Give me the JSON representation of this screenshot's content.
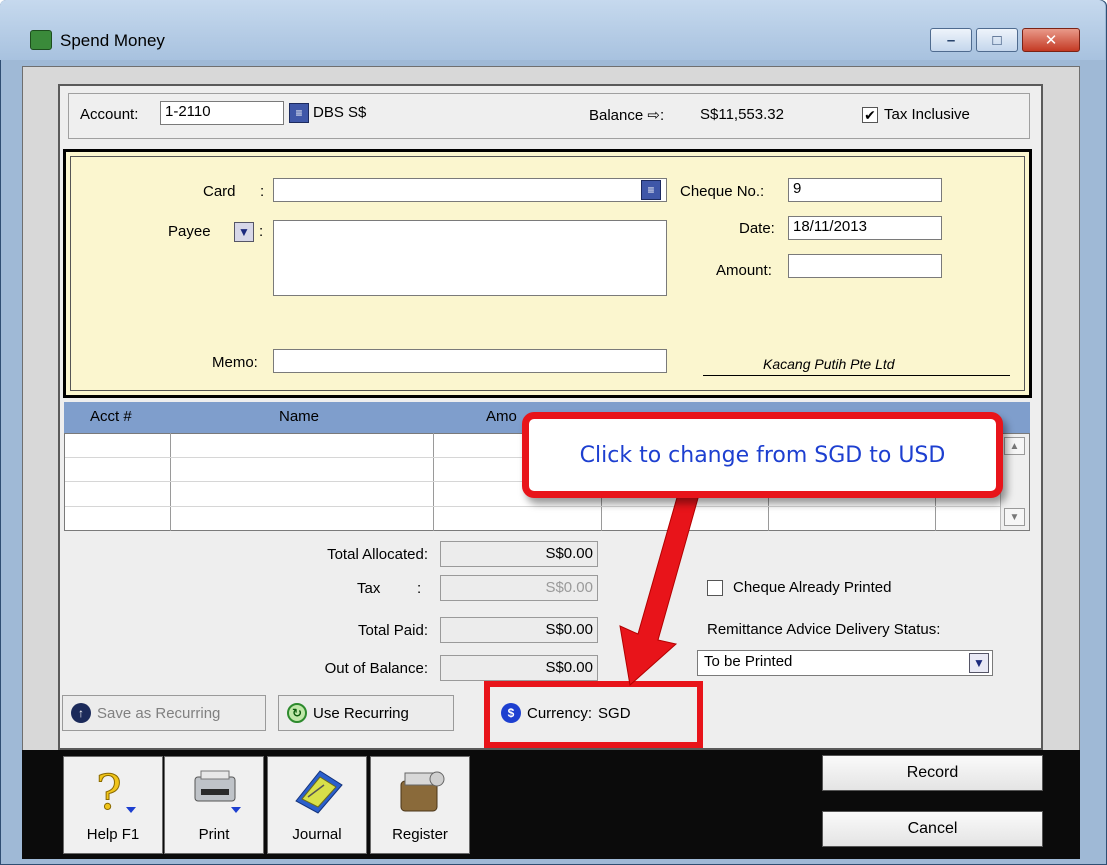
{
  "window": {
    "title": "Spend Money"
  },
  "header": {
    "account_label": "Account:",
    "account_number": "1-2110",
    "account_name": "DBS S$",
    "balance_label": "Balance ⇨:",
    "balance_value": "S$11,553.32",
    "tax_inclusive_label": "Tax Inclusive",
    "tax_inclusive_checked": true
  },
  "card_section": {
    "card_label": "Card",
    "card_value": "",
    "payee_label": "Payee",
    "payee_value": "",
    "memo_label": "Memo:",
    "memo_value": "",
    "cheque_no_label": "Cheque No.:",
    "cheque_no_value": "9",
    "date_label": "Date:",
    "date_value": "18/11/2013",
    "amount_label": "Amount:",
    "amount_value": "",
    "signature": "Kacang Putih Pte Ltd"
  },
  "table": {
    "columns": [
      "Acct #",
      "Name",
      "Amo"
    ],
    "rows": []
  },
  "totals": {
    "allocated_label": "Total Allocated:",
    "allocated_value": "S$0.00",
    "tax_label": "Tax",
    "tax_value": "S$0.00",
    "paid_label": "Total Paid:",
    "paid_value": "S$0.00",
    "out_label": "Out of Balance:",
    "out_value": "S$0.00"
  },
  "options": {
    "cheque_printed_label": "Cheque Already Printed",
    "cheque_printed_checked": false,
    "remittance_label": "Remittance Advice Delivery Status:",
    "remittance_value": "To be Printed"
  },
  "actions": {
    "save_recurring": "Save as Recurring",
    "use_recurring": "Use Recurring",
    "currency_label": "Currency:",
    "currency_value": "SGD"
  },
  "toolbar": {
    "help": "Help F1",
    "print": "Print",
    "journal": "Journal",
    "register": "Register"
  },
  "buttons": {
    "record": "Record",
    "cancel": "Cancel"
  },
  "annotation": {
    "callout": "Click to change from SGD to USD"
  },
  "colors": {
    "callout_border": "#e8141a",
    "callout_text": "#1d3fd0",
    "card_bg": "#fbf6cf",
    "table_header": "#7f9ecc"
  }
}
